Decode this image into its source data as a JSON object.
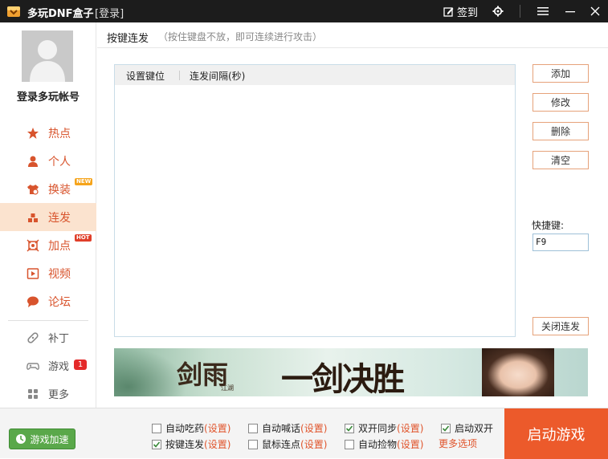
{
  "titlebar": {
    "app_title": "多玩DNF盒子",
    "login_tag": "[登录]",
    "signin_label": "签到"
  },
  "sidebar": {
    "account_label": "登录多玩帐号",
    "items": [
      {
        "label": "热点",
        "icon": "star-icon"
      },
      {
        "label": "个人",
        "icon": "person-icon"
      },
      {
        "label": "换装",
        "icon": "outfit-icon",
        "badge": "NEW"
      },
      {
        "label": "连发",
        "icon": "bars-icon",
        "active": true
      },
      {
        "label": "加点",
        "icon": "skill-icon",
        "badge": "HOT"
      },
      {
        "label": "视频",
        "icon": "play-icon"
      },
      {
        "label": "论坛",
        "icon": "chat-icon"
      },
      {
        "label": "补丁",
        "icon": "patch-icon"
      },
      {
        "label": "游戏",
        "icon": "gamepad-icon",
        "count": "1"
      },
      {
        "label": "更多",
        "icon": "grid-icon"
      }
    ]
  },
  "main": {
    "title": "按键连发",
    "hint": "（按住键盘不放，即可连续进行攻击）",
    "columns": [
      "设置键位",
      "连发间隔(秒)"
    ],
    "buttons": {
      "add": "添加",
      "edit": "修改",
      "delete": "删除",
      "clear": "清空",
      "close": "关闭连发"
    },
    "hotkey_label": "快捷键:",
    "hotkey_value": "F9"
  },
  "banner": {
    "logo_text": "剑雨",
    "logo_sub": "江湖",
    "slogan": "一剑决胜"
  },
  "bottom": {
    "speed_button": "游戏加速",
    "options": [
      {
        "label": "自动吃药",
        "set": "(设置)",
        "checked": false
      },
      {
        "label": "自动喊话",
        "set": "(设置)",
        "checked": false
      },
      {
        "label": "双开同步",
        "set": "(设置)",
        "checked": true
      },
      {
        "label": "启动双开",
        "set": "",
        "checked": true
      },
      {
        "label": "按键连发",
        "set": "(设置)",
        "checked": true
      },
      {
        "label": "鼠标连点",
        "set": "(设置)",
        "checked": false
      },
      {
        "label": "自动捡物",
        "set": "(设置)",
        "checked": false
      }
    ],
    "more_options": "更多选项",
    "start_button": "启动游戏"
  },
  "colors": {
    "accent": "#ec5a2b",
    "nav_text": "#d8542d",
    "active_bg": "#fbe3cf",
    "titlebar_bg": "#1c1c1c",
    "speed_green": "#5aa84a"
  }
}
